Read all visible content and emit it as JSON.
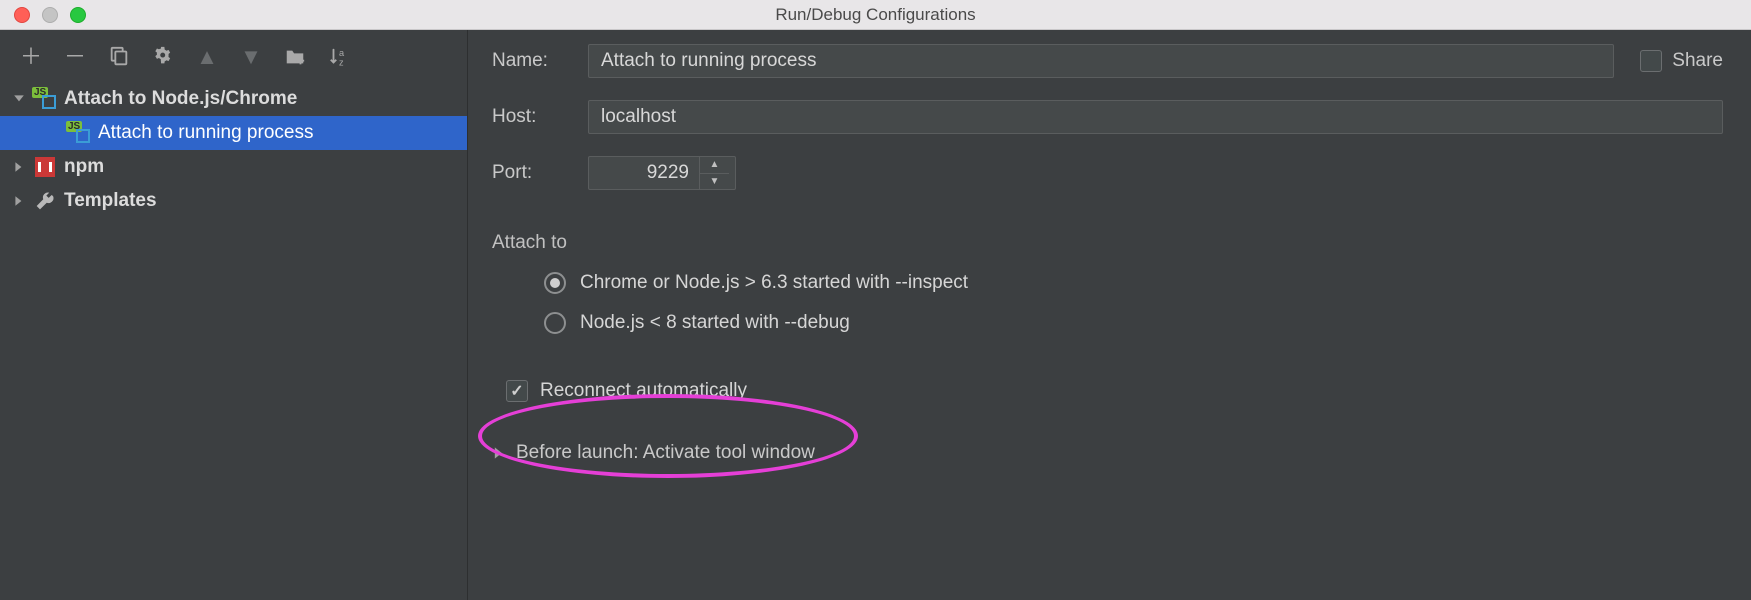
{
  "window": {
    "title": "Run/Debug Configurations"
  },
  "tree": {
    "items": [
      {
        "label": "Attach to Node.js/Chrome"
      },
      {
        "label": "Attach to running process"
      },
      {
        "label": "npm"
      },
      {
        "label": "Templates"
      }
    ]
  },
  "form": {
    "name_label": "Name:",
    "name_value": "Attach to running process",
    "share_label": "Share",
    "host_label": "Host:",
    "host_value": "localhost",
    "port_label": "Port:",
    "port_value": "9229",
    "attach_section": "Attach to",
    "radio1": "Chrome or Node.js > 6.3 started with --inspect",
    "radio2": "Node.js < 8 started with --debug",
    "reconnect": "Reconnect automatically",
    "before_launch": "Before launch: Activate tool window"
  }
}
